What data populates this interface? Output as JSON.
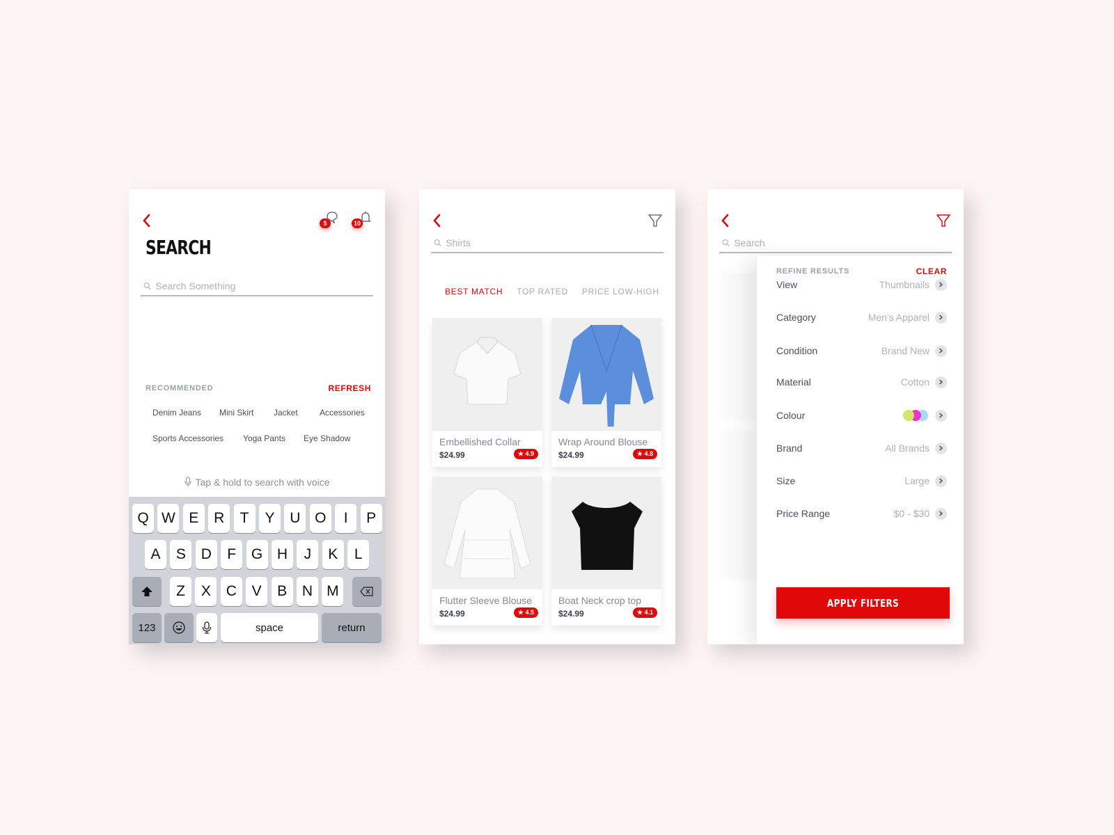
{
  "colors": {
    "accent": "#e00909",
    "background": "#fdf4f4",
    "text": "#4a4f5c",
    "muted": "#aeb2bc"
  },
  "search_screen": {
    "title": "SEARCH",
    "back_icon": "chevron-left-icon",
    "messages": {
      "icon": "chat-bubble-icon",
      "badge": "5"
    },
    "notifications": {
      "icon": "bell-icon",
      "badge": "10"
    },
    "search": {
      "placeholder": "Search Something",
      "value": ""
    },
    "recommended_label": "RECOMMENDED",
    "refresh_label": "REFRESH",
    "chips": [
      "Denim Jeans",
      "Mini Skirt",
      "Jacket",
      "Accessories",
      "Sports Accessories",
      "Yoga Pants",
      "Eye Shadow"
    ],
    "voice_hint": "Tap & hold to search with voice",
    "keyboard": {
      "row1": [
        "Q",
        "W",
        "E",
        "R",
        "T",
        "Y",
        "U",
        "O",
        "I",
        "P"
      ],
      "row2": [
        "A",
        "S",
        "D",
        "F",
        "G",
        "H",
        "J",
        "K",
        "L"
      ],
      "row3": [
        "Z",
        "X",
        "C",
        "V",
        "B",
        "N",
        "M"
      ],
      "numbers": "123",
      "space": "space",
      "return": "return"
    }
  },
  "results_screen": {
    "search": {
      "placeholder": "Search",
      "value": "Shirts"
    },
    "sort_tabs": [
      {
        "label": "BEST MATCH",
        "active": true
      },
      {
        "label": "TOP RATED",
        "active": false
      },
      {
        "label": "PRICE LOW-HIGH",
        "active": false
      }
    ],
    "products": [
      {
        "name": "Embellished Collar",
        "price": "$24.99",
        "rating": "4.9",
        "image": "white-puff-sleeve-blouse"
      },
      {
        "name": "Wrap Around Blouse",
        "price": "$24.99",
        "rating": "4.8",
        "image": "blue-wrap-blouse"
      },
      {
        "name": "Flutter Sleeve Blouse",
        "price": "$24.99",
        "rating": "4.5",
        "image": "white-flutter-blouse"
      },
      {
        "name": "Boat Neck crop top",
        "price": "$24.99",
        "rating": "4.1",
        "image": "black-crop-top"
      }
    ]
  },
  "filter_screen": {
    "search": {
      "placeholder": "Search",
      "value": ""
    },
    "heading": "REFINE RESULTS",
    "clear_label": "CLEAR",
    "filters": [
      {
        "label": "View",
        "value": "Thumbnails"
      },
      {
        "label": "Category",
        "value": "Men's Apparel"
      },
      {
        "label": "Condition",
        "value": "Brand New"
      },
      {
        "label": "Material",
        "value": "Cotton"
      },
      {
        "label": "Colour",
        "value": "",
        "swatches": [
          "#d6e56c",
          "#ee35c7",
          "#a9d8fb"
        ]
      },
      {
        "label": "Brand",
        "value": "All Brands"
      },
      {
        "label": "Size",
        "value": "Large"
      },
      {
        "label": "Price Range",
        "value": "$0 - $30"
      }
    ],
    "apply_label": "APPLY FILTERS"
  }
}
